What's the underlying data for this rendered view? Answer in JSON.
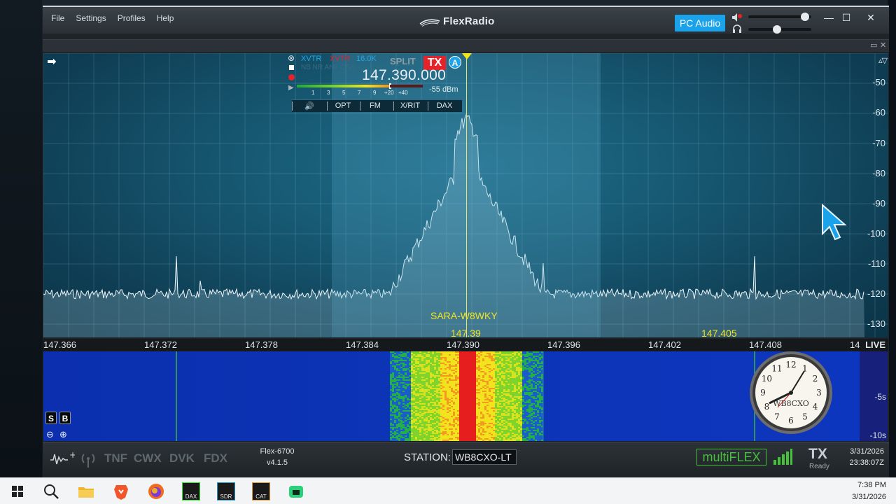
{
  "menu": {
    "file": "File",
    "settings": "Settings",
    "profiles": "Profiles",
    "help": "Help"
  },
  "brand": {
    "name": "FlexRadio"
  },
  "audio": {
    "pc_audio_label": "PC Audio",
    "speaker_volume": 0.9,
    "headphone_volume": 0.45
  },
  "window_controls": {
    "minimize": "—",
    "maximize": "☐",
    "close": "✕"
  },
  "slice": {
    "xvtr_1": "XVTR",
    "xvtr_2": "XVTR",
    "bandwidth": "16.0K",
    "split": "SPLIT",
    "tx": "TX",
    "letter": "A",
    "flags": "NB NR ANF QSK",
    "frequency": "147.390.000",
    "signal_level": "-55 dBm",
    "meter_ticks": [
      "1",
      "3",
      "5",
      "7",
      "9",
      "+20",
      "+40"
    ],
    "buttons": {
      "speaker": "🔊",
      "opt": "OPT",
      "mode": "FM",
      "xrit": "X/RIT",
      "dax": "DAX"
    }
  },
  "panadapter": {
    "db_labels": [
      "-50",
      "-60",
      "-70",
      "-80",
      "-90",
      "-100",
      "-110",
      "-120",
      "-130"
    ],
    "spot_label": "SARA-W8WKY",
    "center_marker": "147.39",
    "second_marker": "147.405",
    "freq_labels": [
      "147.366",
      "147.372",
      "147.378",
      "147.384",
      "147.390",
      "147.396",
      "147.402",
      "147.408",
      "14"
    ],
    "live": "LIVE"
  },
  "waterfall": {
    "time_labels": [
      "-5s",
      "-10s"
    ],
    "s_button": "S",
    "b_button": "B",
    "zoom_out": "⊖",
    "zoom_in": "⊕",
    "clock_label": "WB8CXO",
    "clock_numbers": [
      "12",
      "1",
      "2",
      "3",
      "4",
      "5",
      "6",
      "7",
      "8",
      "9",
      "10",
      "11"
    ]
  },
  "status": {
    "tnf": "TNF",
    "cwx": "CWX",
    "dvk": "DVK",
    "fdx": "FDX",
    "model": "Flex-6700",
    "version": "v4.1.5",
    "station_label": "STATION:",
    "station_name": "WB8CXO-LT",
    "multiflex": "multiFLEX",
    "tx": "TX",
    "tx_state": "Ready",
    "date": "3/31/2026",
    "time": "23:38:07Z"
  },
  "taskbar": {
    "apps": [
      "windows-start",
      "search",
      "file-explorer",
      "brave",
      "firefox",
      "dax",
      "sdr",
      "cat",
      "app-green"
    ],
    "dax_label": "DAX",
    "sdr_label": "SDR",
    "cat_label": "CAT",
    "time": "7:38 PM",
    "date": "3/31/2026"
  },
  "colors": {
    "accent_blue": "#1aa3ea",
    "tx_red": "#e6232a",
    "marker_yellow": "#f2e31e",
    "multiflex_green": "#45c13a"
  }
}
